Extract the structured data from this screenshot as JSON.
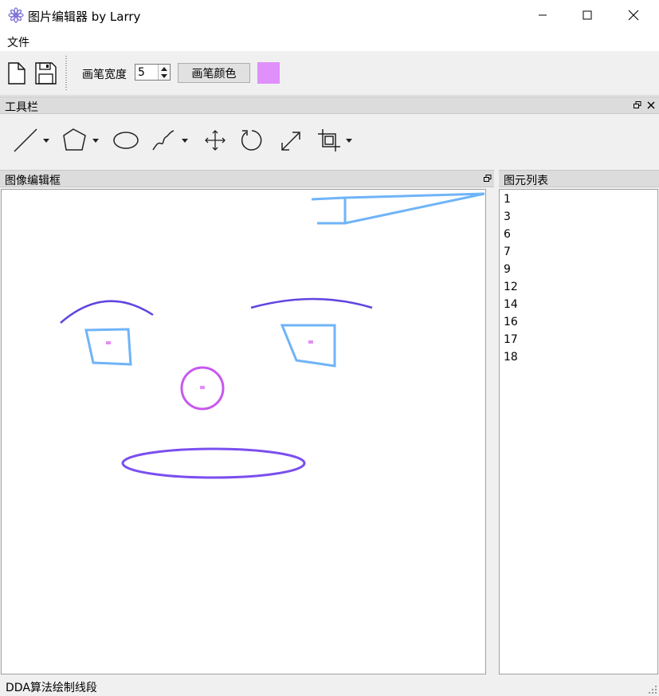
{
  "window": {
    "title": "图片编辑器 by Larry",
    "icon": "flower-icon"
  },
  "menu": {
    "items": [
      "文件"
    ]
  },
  "toolbar": {
    "new_icon": "new-file-icon",
    "save_icon": "save-icon",
    "pen_width_label": "画笔宽度",
    "pen_width_value": "5",
    "pen_color_button": "画笔颜色",
    "pen_color": "#df90fb"
  },
  "tools_dock": {
    "title": "工具栏",
    "tools": [
      "line-tool-icon",
      "polygon-tool-icon",
      "ellipse-tool-icon",
      "curve-tool-icon",
      "move-tool-icon",
      "rotate-tool-icon",
      "scale-tool-icon",
      "crop-tool-icon"
    ]
  },
  "canvas_dock": {
    "title": "图像编辑框"
  },
  "list_dock": {
    "title": "图元列表",
    "items": [
      "1",
      "3",
      "6",
      "7",
      "9",
      "12",
      "14",
      "16",
      "17",
      "18"
    ]
  },
  "status": {
    "text": "DDA算法绘制线段"
  },
  "colors": {
    "light_blue": "#6fb4f8",
    "purple": "#6144e0",
    "magenta": "#c858f0",
    "pink_dot": "#e28ef5",
    "ellipse_purple": "#7a4ff0"
  }
}
